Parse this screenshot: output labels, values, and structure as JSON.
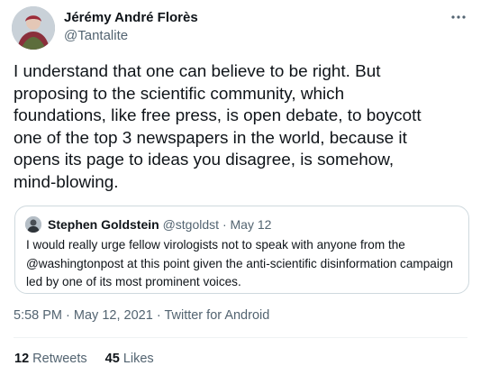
{
  "author": {
    "name": "Jérémy André Florès",
    "handle": "@Tantalite"
  },
  "tweet": {
    "text": "I understand that one can believe to be right. But\nproposing to the scientific community, which\nfoundations, like free press, is open debate, to boycott\none of the top 3 newspapers in the world, because it\nopens its page to ideas you disagree, is somehow,\nmind-blowing.",
    "time": "5:58 PM",
    "separator": "·",
    "date": "May 12, 2021",
    "client": "Twitter for Android"
  },
  "quoted_tweet": {
    "name": "Stephen Goldstein",
    "handle": "@stgoldst",
    "separator": "·",
    "date": "May 12",
    "text": "I would really urge fellow virologists not to speak with anyone from the\n@washingtonpost at this point given the anti-scientific disinformation campaign\nled by one of its most prominent voices."
  },
  "stats": {
    "retweets_count": "12",
    "retweets_label": "Retweets",
    "likes_count": "45",
    "likes_label": "Likes"
  },
  "icons": {
    "more": "more-horizontal-icon"
  },
  "colors": {
    "text_primary": "#0f1419",
    "text_secondary": "#536471",
    "border": "#cfd9de"
  }
}
